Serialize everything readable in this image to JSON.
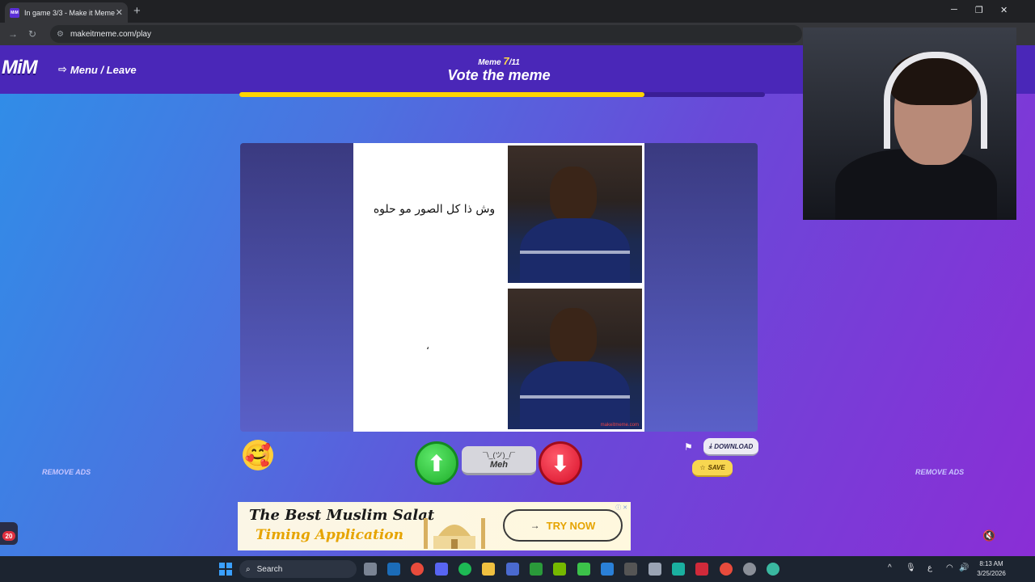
{
  "browser": {
    "tab_title": "In game 3/3 - Make it Meme",
    "favicon_text": "MiM",
    "url": "makeitmeme.com/play"
  },
  "header": {
    "logo": "MiM",
    "menu_leave": "Menu / Leave",
    "meme_label": "Meme",
    "meme_current": "7",
    "meme_total": "/11",
    "phase": "Vote the meme",
    "progress_fraction": 0.77
  },
  "meme": {
    "top_text": "وش ذا كل الصور مو حلوه",
    "bottom_text": "،"
  },
  "actions": {
    "meh_face": "¯\\_(ツ)_/¯",
    "meh_label": "Meh",
    "download_label": "DOWNLOAD",
    "save_label": "SAVE",
    "remove_ads_left": "REMOVE ADS",
    "remove_ads_right": "REMOVE ADS"
  },
  "ad": {
    "line1": "The Best Muslim Salat",
    "line2": "Timing Application",
    "cta": "TRY NOW"
  },
  "chat": {
    "badge": "20"
  },
  "taskbar": {
    "search_placeholder": "Search",
    "time": "8:13 AM",
    "date": "3/25/2026",
    "lang": "ع"
  },
  "colors": {
    "page_gradient_start": "#2f8ee8",
    "page_gradient_end": "#8a2ed6",
    "topbar": "#4a27b8",
    "progress": "#ffd400",
    "vote_up": "#1fae2a",
    "vote_down": "#d8102a",
    "ad_accent": "#e6a400"
  },
  "icons": [
    "minimize-icon",
    "maximize-icon",
    "close-icon",
    "reload-icon",
    "leave-icon",
    "flag-icon",
    "download-icon",
    "star-icon",
    "mute-icon",
    "windows-start-icon",
    "search-icon"
  ]
}
